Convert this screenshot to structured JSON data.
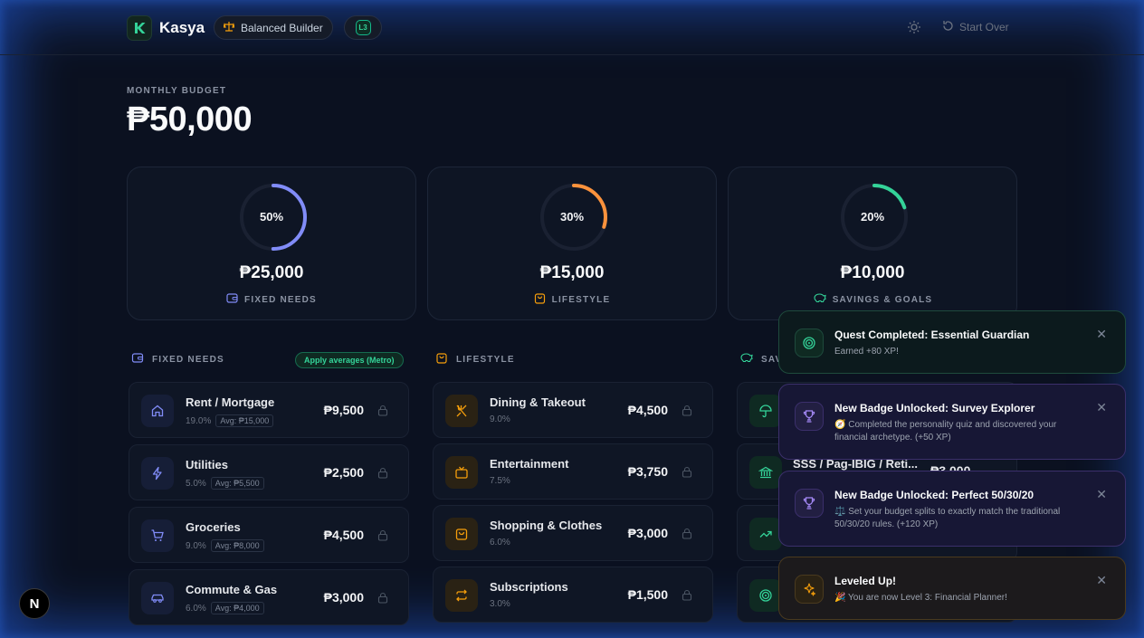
{
  "header": {
    "brand": "Kasya",
    "archetype": "Balanced Builder",
    "level_badge": "L3",
    "start_over": "Start Over"
  },
  "budget": {
    "label": "MONTHLY BUDGET",
    "amount": "₱50,000"
  },
  "cards": [
    {
      "percent_label": "50%",
      "percent": 50,
      "amount": "₱25,000",
      "label": "FIXED NEEDS",
      "color": "#818cf8",
      "icon": "wallet-icon"
    },
    {
      "percent_label": "30%",
      "percent": 30,
      "amount": "₱15,000",
      "label": "LIFESTYLE",
      "color": "#fb923c",
      "icon": "shopping-bag-icon"
    },
    {
      "percent_label": "20%",
      "percent": 20,
      "amount": "₱10,000",
      "label": "SAVINGS & GOALS",
      "color": "#34d399",
      "icon": "piggy-bank-icon"
    }
  ],
  "sections": {
    "fixed": {
      "title": "FIXED NEEDS",
      "apply_label": "Apply averages (Metro)"
    },
    "lifestyle": {
      "title": "LIFESTYLE"
    },
    "savings": {
      "title": "SAV"
    }
  },
  "fixed_items": [
    {
      "name": "Rent / Mortgage",
      "pct": "19.0%",
      "avg": "Avg: ₱15,000",
      "value": "₱9,500",
      "icon": "home-icon"
    },
    {
      "name": "Utilities",
      "pct": "5.0%",
      "avg": "Avg: ₱5,500",
      "value": "₱2,500",
      "icon": "bolt-icon"
    },
    {
      "name": "Groceries",
      "pct": "9.0%",
      "avg": "Avg: ₱8,000",
      "value": "₱4,500",
      "icon": "cart-icon"
    },
    {
      "name": "Commute & Gas",
      "pct": "6.0%",
      "avg": "Avg: ₱4,000",
      "value": "₱3,000",
      "icon": "car-icon"
    }
  ],
  "lifestyle_items": [
    {
      "name": "Dining & Takeout",
      "pct": "9.0%",
      "value": "₱4,500",
      "icon": "utensils-icon"
    },
    {
      "name": "Entertainment",
      "pct": "7.5%",
      "value": "₱3,750",
      "icon": "tv-icon"
    },
    {
      "name": "Shopping & Clothes",
      "pct": "6.0%",
      "value": "₱3,000",
      "icon": "bag-icon"
    },
    {
      "name": "Subscriptions",
      "pct": "3.0%",
      "value": "₱1,500",
      "icon": "repeat-icon"
    }
  ],
  "savings_partial": {
    "name": "SSS / Pag-IBIG / Reti...",
    "value": "₱3,000"
  },
  "toasts": [
    {
      "title": "Quest Completed: Essential Guardian",
      "body": "Earned +80 XP!",
      "icon": "target-icon"
    },
    {
      "title": "New Badge Unlocked: Survey Explorer",
      "body": "🧭 Completed the personality quiz and discovered your financial archetype. (+50 XP)",
      "icon": "trophy-icon"
    },
    {
      "title": "New Badge Unlocked: Perfect 50/30/20",
      "body": "⚖️ Set your budget splits to exactly match the traditional 50/30/20 rules. (+120 XP)",
      "icon": "trophy-icon"
    },
    {
      "title": "Leveled Up!",
      "body": "🎉 You are now Level 3: Financial Planner!",
      "icon": "sparkles-icon"
    }
  ],
  "dev_badge": "N",
  "colors": {
    "accent_green": "#34d399",
    "needs": "#818cf8",
    "lifestyle": "#fb923c",
    "savings": "#34d399"
  }
}
